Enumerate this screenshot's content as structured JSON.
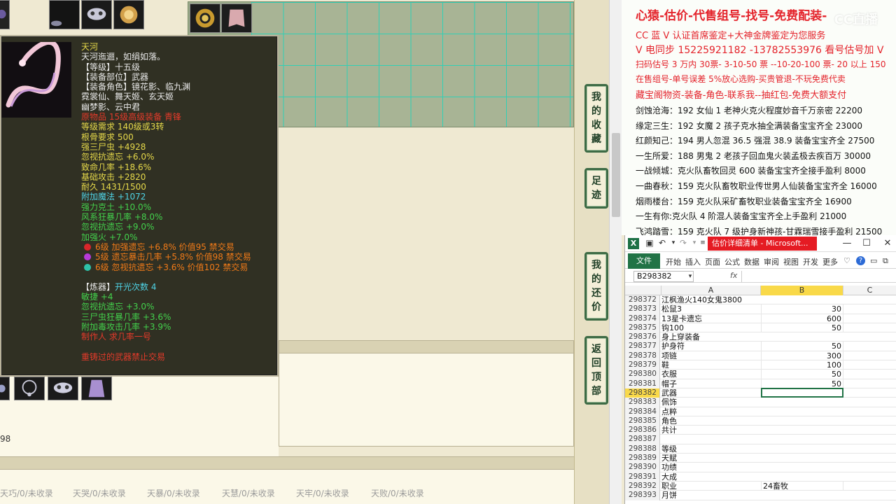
{
  "tooltip": {
    "name": "天河",
    "desc": "天河迤逦，如绢如落。",
    "level": "【等级】十五级",
    "slot": "【装备部位】武器",
    "roles1": "【装备角色】镜花影、临九渊",
    "roles2": "霓裳仙、舞天姬、玄天姬",
    "roles3": "幽梦影、云中君",
    "origin": "原物品 15级高级装备 青锋",
    "req_level": "等级需求 140级或3转",
    "req_bone": "根骨要求 500",
    "stats": [
      {
        "text": "强三尸虫 +4928",
        "color": "y"
      },
      {
        "text": "忽视抗遗忘 +6.0%",
        "color": "y"
      },
      {
        "text": "致命几率 +18.6%",
        "color": "y"
      },
      {
        "text": "基础攻击 +2820",
        "color": "y"
      },
      {
        "text": "耐久 1431/1500",
        "color": "y"
      },
      {
        "text": "附加魔法 +1072",
        "color": "c"
      },
      {
        "text": "强力克土 +10.0%",
        "color": "g"
      },
      {
        "text": "风系狂暴几率 +8.0%",
        "color": "g"
      },
      {
        "text": "忽视抗遗忘 +9.0%",
        "color": "g"
      },
      {
        "text": "加强火 +7.0%",
        "color": "g"
      }
    ],
    "gems": [
      {
        "text": "6级 加强遗忘 +6.8% 价值95 禁交易",
        "color": "#d8262a"
      },
      {
        "text": "5级 遗忘暴击几率 +5.8% 价值98 禁交易",
        "color": "#b63ad8"
      },
      {
        "text": "6级 忽视抗遗忘 +3.6% 价值102 禁交易",
        "color": "#2ec1a8"
      }
    ],
    "refine_label": "【炼器】",
    "refine_value": "开光次数 4",
    "refine_stats": [
      "敏捷 +4",
      "忽视抗遗忘 +3.0%",
      "三尸虫狂暴几率 +3.6%",
      "附加毒攻击几率 +3.9%"
    ],
    "maker": "制作人 求几率一号",
    "warn": "重铸过的武器禁止交易"
  },
  "side_buttons": [
    "我的收藏",
    "足迹",
    "我的还价",
    "返回顶部"
  ],
  "row_number": "98",
  "stars": [
    "天巧/0/未收录",
    "天哭/0/未收录",
    "天暴/0/未收录",
    "天慧/0/未收录",
    "天牢/0/未收录",
    "天败/0/未收录"
  ],
  "promo": {
    "title": "心猿-估价-代售组号-找号-免费配装-",
    "watermark": "CC直播",
    "lines": [
      "CC 蓝 V 认证首席鉴定+大神金牌鉴定为您服务",
      "V 电同步 15225921182 -13782553976 看号估号加 V",
      "扫码估号 3 万内 30票- 3-10-50 票  --10-20-100 票- 20 以上 150",
      "在售组号-单号误差 5%放心选购-买贵管退-不玩免费代卖",
      "藏宝阁物资-装备-角色-联系我--抽红包-免费大额支付"
    ],
    "listings": [
      "剑蚀沧海：192 女仙 1 老神火克火程度妙音千万亲密 22200",
      "缘定三生：192 女魔 2 孩子克水抽全满装备宝宝齐全 23000",
      "红颜知己：194 男人忽混 36.5 强混 38.9 装备宝宝齐全 27500",
      "一生所爱：188 男鬼 2 老孩子回血鬼火装孟极去疾百万 30000",
      "一战倾城：克火队畜牧回灵 600 装备宝宝齐全接手盈利 8000",
      "一曲春秋：159 克火队畜牧职业传世男人仙装备宝宝齐全 16000",
      "烟雨楼台：159 克火队采矿畜牧职业装备宝宝齐全 16900",
      "一生有你:克火队 4 阶混人装备宝宝齐全上手盈利 21000",
      "飞鸿踏雪：159 克火队 7 级护身新神孩-甘霖瑞雪接手盈利 21500"
    ]
  },
  "excel": {
    "doc_title": "估价详细清单 - Microsoft...",
    "file_tab": "文件",
    "tabs": [
      "开始",
      "插入",
      "页面",
      "公式",
      "数据",
      "审阅",
      "视图",
      "开发",
      "更多"
    ],
    "name_box": "B298382",
    "fx": "fx",
    "columns": [
      "A",
      "B",
      "C"
    ],
    "rows": [
      {
        "n": "298372",
        "a": "江枫渔火140女鬼3800",
        "b": ""
      },
      {
        "n": "298373",
        "a": "松鼠3",
        "b": "30"
      },
      {
        "n": "298374",
        "a": "13星卡遗忘",
        "b": "600"
      },
      {
        "n": "298375",
        "a": "钩100",
        "b": "50"
      },
      {
        "n": "298376",
        "a": "身上穿装备",
        "b": ""
      },
      {
        "n": "298377",
        "a": "护身符",
        "b": "50"
      },
      {
        "n": "298378",
        "a": "项链",
        "b": "300"
      },
      {
        "n": "298379",
        "a": "鞋",
        "b": "100"
      },
      {
        "n": "298380",
        "a": "衣服",
        "b": "50"
      },
      {
        "n": "298381",
        "a": "帽子",
        "b": "50"
      },
      {
        "n": "298382",
        "a": "武器",
        "b": ""
      },
      {
        "n": "298383",
        "a": "佩饰",
        "b": ""
      },
      {
        "n": "298384",
        "a": "点粹",
        "b": ""
      },
      {
        "n": "298385",
        "a": "角色",
        "b": ""
      },
      {
        "n": "298386",
        "a": "共计",
        "b": ""
      },
      {
        "n": "298387",
        "a": "",
        "b": ""
      },
      {
        "n": "298388",
        "a": "等级",
        "b": ""
      },
      {
        "n": "298389",
        "a": "天赋",
        "b": ""
      },
      {
        "n": "298390",
        "a": "功绩",
        "b": ""
      },
      {
        "n": "298391",
        "a": "大成",
        "b": ""
      },
      {
        "n": "298392",
        "a": "职业",
        "b": "24畜牧"
      },
      {
        "n": "298393",
        "a": "月饼",
        "b": ""
      }
    ]
  }
}
